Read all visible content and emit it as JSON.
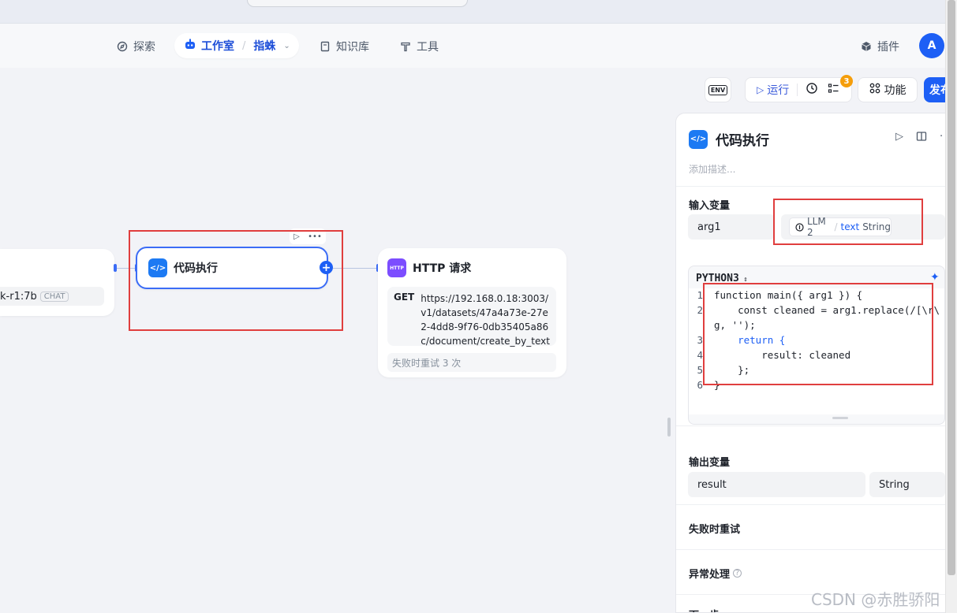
{
  "nav": {
    "explore": "探索",
    "studio": "工作室",
    "studio_sub": "指蛛",
    "knowledge": "知识库",
    "tools": "工具",
    "plugins": "插件",
    "avatar_letter": "A"
  },
  "toolbar": {
    "env": "ENV",
    "run": "运行",
    "badge_count": "3",
    "features": "功能",
    "publish": "发布"
  },
  "canvas": {
    "left_node_model": "k-r1:7b",
    "left_node_tag": "CHAT",
    "code_node_title": "代码执行",
    "http_node_title": "HTTP 请求",
    "http_icon_text": "HTTP",
    "http_method": "GET",
    "http_url": "https://192.168.0.18:3003/v1/datasets/47a4a73e-27e2-4dd8-9f76-0db35405a86c/document/create_by_text",
    "http_retry": "失败时重试 3 次"
  },
  "panel": {
    "title": "代码执行",
    "description_placeholder": "添加描述...",
    "input_vars_title": "输入变量",
    "input_var_name": "arg1",
    "input_ref_source": "LLM 2",
    "input_ref_var": "text",
    "input_ref_type": "String",
    "code_language": "PYTHON3",
    "code_lines": [
      {
        "n": "1",
        "text": "function main({ arg1 }) {"
      },
      {
        "n": "2",
        "text": "    const cleaned = arg1.replace(/[\\r\\"
      },
      {
        "n": "",
        "text": "g, '');"
      },
      {
        "n": "3",
        "text": "    return {"
      },
      {
        "n": "4",
        "text": "        result: cleaned"
      },
      {
        "n": "5",
        "text": "    };"
      },
      {
        "n": "6",
        "text": "}"
      }
    ],
    "output_vars_title": "输出变量",
    "output_var_name": "result",
    "output_var_type": "String",
    "retry_title": "失败时重试",
    "error_title": "异常处理",
    "next_title": "下一步"
  },
  "watermark": "CSDN @赤胜骄阳"
}
